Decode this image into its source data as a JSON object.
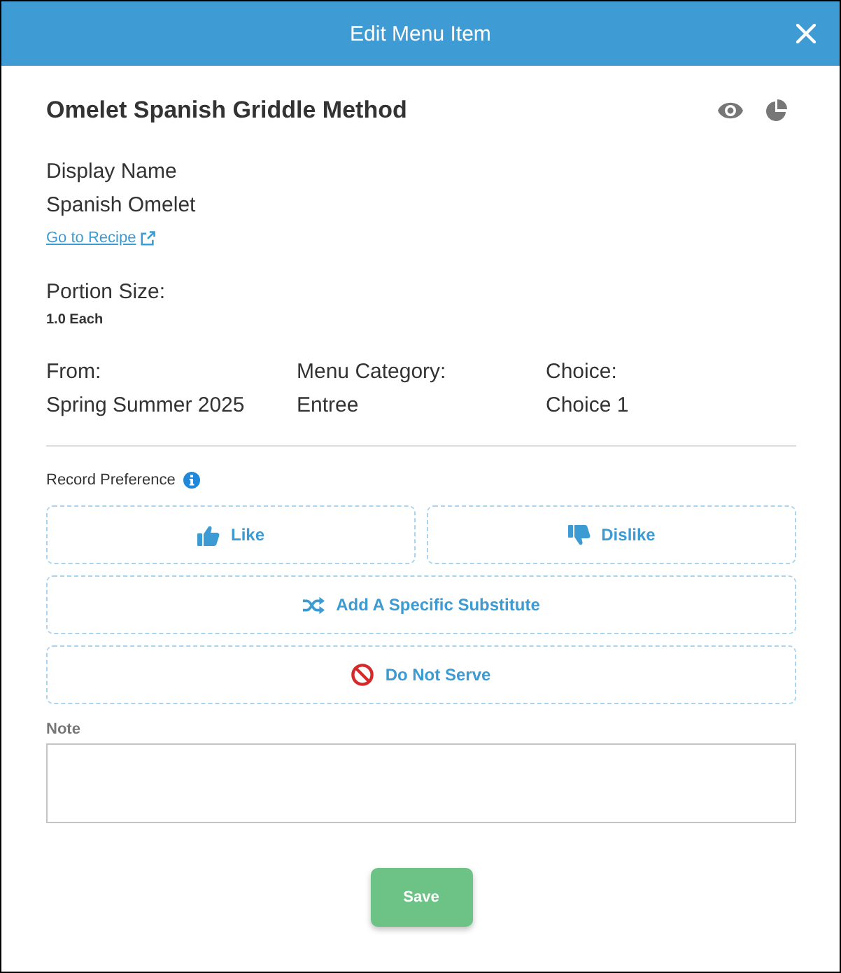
{
  "dialog": {
    "title": "Edit Menu Item"
  },
  "item": {
    "name": "Omelet Spanish Griddle Method"
  },
  "details": {
    "display_name_label": "Display Name",
    "display_name": "Spanish Omelet",
    "recipe_link": "Go to Recipe",
    "portion_label": "Portion Size:",
    "portion": "1.0 Each"
  },
  "fields": [
    {
      "label": "From:",
      "value": "Spring Summer 2025"
    },
    {
      "label": "Menu Category:",
      "value": "Entree"
    },
    {
      "label": "Choice:",
      "value": "Choice 1"
    }
  ],
  "preference": {
    "label": "Record Preference",
    "options": [
      {
        "kind": "like",
        "label": "Like",
        "selected": false
      },
      {
        "kind": "dislike",
        "label": "Dislike",
        "selected": false
      },
      {
        "kind": "substitute",
        "label": "Add A Specific Substitute",
        "selected": false
      },
      {
        "kind": "do_not_serve",
        "label": "Do Not Serve",
        "selected": false
      }
    ]
  },
  "note": {
    "label": "Note"
  },
  "buttons": [
    {
      "label": "Save"
    }
  ]
}
